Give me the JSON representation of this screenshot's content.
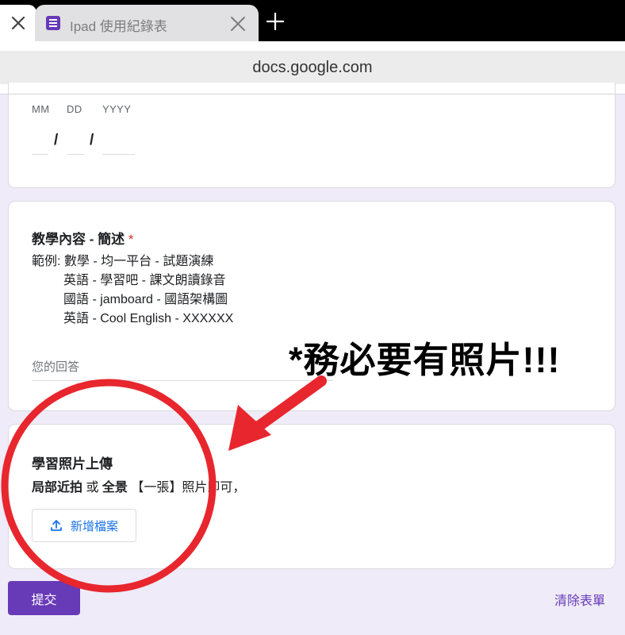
{
  "browser": {
    "tab_title": "Ipad 使用紀錄表",
    "url": "docs.google.com",
    "colors": {
      "form_accent": "#673ab7",
      "link_blue": "#1a73e8",
      "annotation_red": "#e8262e"
    }
  },
  "date_question": {
    "labels": [
      "MM",
      "DD",
      "YYYY"
    ],
    "separator": "/"
  },
  "content_question": {
    "title": "教學內容 - 簡述",
    "required_mark": "*",
    "description_lines": [
      "範例: 數學 - 均一平台 - 試題演練",
      "         英語 - 學習吧 - 課文朗讀錄音",
      "         國語 - jamboard - 國語架構圖",
      "         英語 - Cool English - XXXXXX"
    ],
    "answer_placeholder": "您的回答"
  },
  "photo_question": {
    "title": "學習照片上傳",
    "desc_bold_1": "局部近拍",
    "desc_mid": " 或 ",
    "desc_bold_2": "全景",
    "desc_rest": " 【一張】照片即可，",
    "add_file_label": "新增檔案",
    "add_file_icon": "upload-icon"
  },
  "footer": {
    "submit_label": "提交",
    "clear_label": "清除表單"
  },
  "annotation": {
    "text": "*務必要有照片!!!"
  }
}
